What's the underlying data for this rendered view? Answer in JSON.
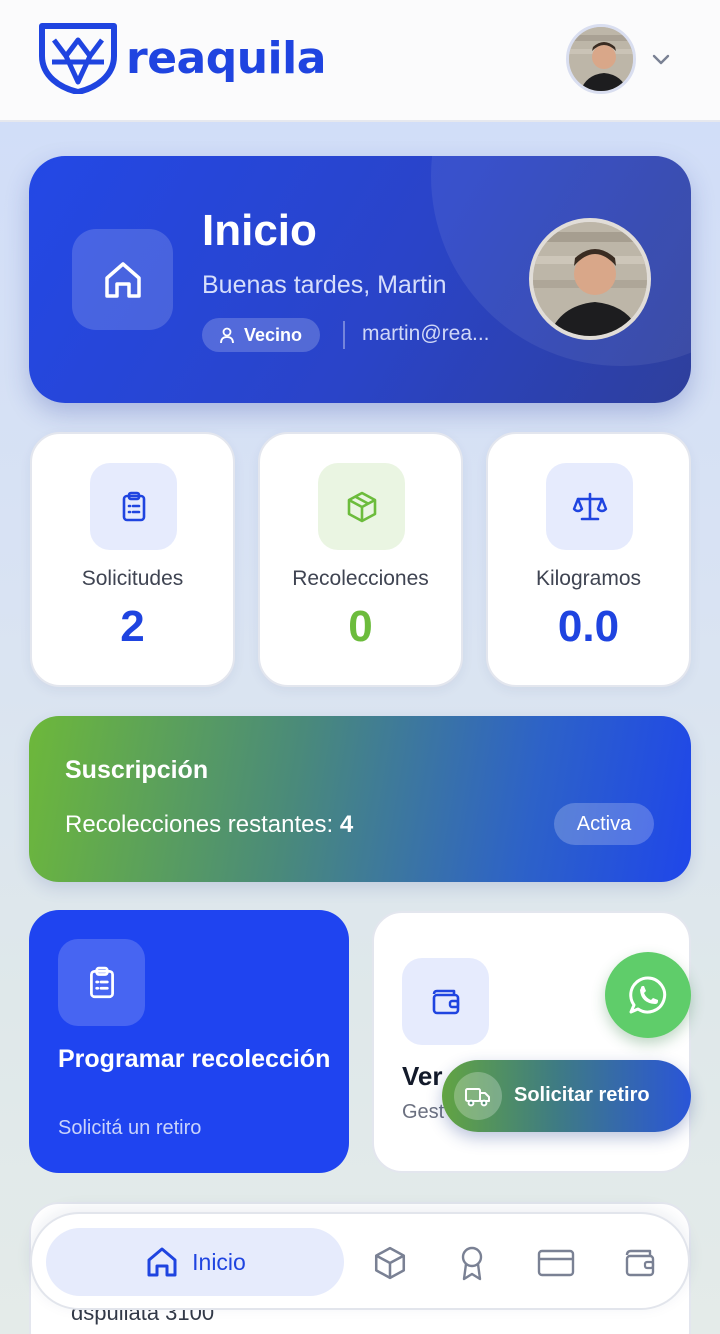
{
  "brand": {
    "name": "reaquila",
    "color": "#1f44e0"
  },
  "header": {
    "avatar": "user-avatar",
    "menu_icon": "chevron-down-icon"
  },
  "hero": {
    "title": "Inicio",
    "greeting": "Buenas tardes, Martin",
    "role": "Vecino",
    "email": "martin@rea..."
  },
  "stats": [
    {
      "label": "Solicitudes",
      "value": "2",
      "icon": "clipboard-icon",
      "color": "#1f44e0"
    },
    {
      "label": "Recolecciones",
      "value": "0",
      "icon": "package-icon",
      "color": "#6cbc3c"
    },
    {
      "label": "Kilogramos",
      "value": "0.0",
      "icon": "scale-icon",
      "color": "#1f44e0"
    }
  ],
  "subscription": {
    "title": "Suscripción",
    "remaining_label": "Recolecciones restantes:",
    "remaining_value": "4",
    "status": "Activa"
  },
  "actions": {
    "schedule": {
      "title": "Programar recolección",
      "subtitle": "Solicitá un retiro"
    },
    "wallet": {
      "title": "Ver",
      "subtitle": "Gest"
    }
  },
  "fab": {
    "label": "Solicitar retiro"
  },
  "bottom_card": {
    "text": "dspuilata 3100"
  },
  "nav": {
    "active_label": "Inicio",
    "items": [
      "home-icon",
      "package-icon",
      "award-icon",
      "credit-card-icon",
      "wallet-icon"
    ]
  }
}
